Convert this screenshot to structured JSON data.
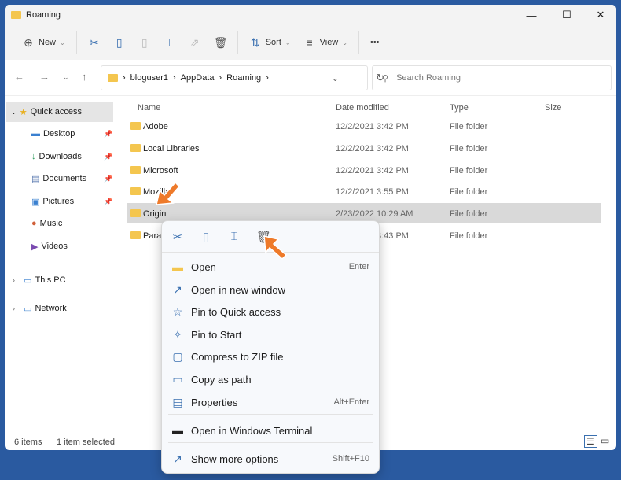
{
  "window": {
    "title": "Roaming",
    "minimize": "—",
    "maximize": "☐",
    "close": "✕"
  },
  "toolbar": {
    "new_label": "New",
    "sort_label": "Sort",
    "view_label": "View",
    "more": "•••"
  },
  "address": {
    "crumbs": [
      "bloguser1",
      "AppData",
      "Roaming"
    ],
    "search_placeholder": "Search Roaming"
  },
  "sidebar": {
    "items": [
      {
        "label": "Quick access",
        "icon": "star-icon"
      },
      {
        "label": "Desktop",
        "icon": "desktop-icon"
      },
      {
        "label": "Downloads",
        "icon": "download-icon"
      },
      {
        "label": "Documents",
        "icon": "documents-icon"
      },
      {
        "label": "Pictures",
        "icon": "pictures-icon"
      },
      {
        "label": "Music",
        "icon": "music-icon"
      },
      {
        "label": "Videos",
        "icon": "videos-icon"
      },
      {
        "label": "This PC",
        "icon": "pc-icon"
      },
      {
        "label": "Network",
        "icon": "network-icon"
      }
    ]
  },
  "columns": {
    "name": "Name",
    "date": "Date modified",
    "type": "Type",
    "size": "Size"
  },
  "files": [
    {
      "name": "Adobe",
      "date": "12/2/2021 3:42 PM",
      "type": "File folder"
    },
    {
      "name": "Local Libraries",
      "date": "12/2/2021 3:42 PM",
      "type": "File folder"
    },
    {
      "name": "Microsoft",
      "date": "12/2/2021 3:42 PM",
      "type": "File folder"
    },
    {
      "name": "Mozilla",
      "date": "12/2/2021 3:55 PM",
      "type": "File folder"
    },
    {
      "name": "Origin",
      "date": "2/23/2022 10:29 AM",
      "type": "File folder"
    },
    {
      "name": "Parallels",
      "date": "12/2/2021 3:43 PM",
      "type": "File folder"
    }
  ],
  "status": {
    "count": "6 items",
    "selected": "1 item selected"
  },
  "context_menu": {
    "items": [
      {
        "label": "Open",
        "shortcut": "Enter"
      },
      {
        "label": "Open in new window",
        "shortcut": ""
      },
      {
        "label": "Pin to Quick access",
        "shortcut": ""
      },
      {
        "label": "Pin to Start",
        "shortcut": ""
      },
      {
        "label": "Compress to ZIP file",
        "shortcut": ""
      },
      {
        "label": "Copy as path",
        "shortcut": ""
      },
      {
        "label": "Properties",
        "shortcut": "Alt+Enter"
      },
      {
        "label": "Open in Windows Terminal",
        "shortcut": ""
      },
      {
        "label": "Show more options",
        "shortcut": "Shift+F10"
      }
    ]
  },
  "colors": {
    "accent": "#3a70b0",
    "arrow": "#ee7a2a",
    "folder": "#f4c64f",
    "selection": "#d9d9d9"
  }
}
